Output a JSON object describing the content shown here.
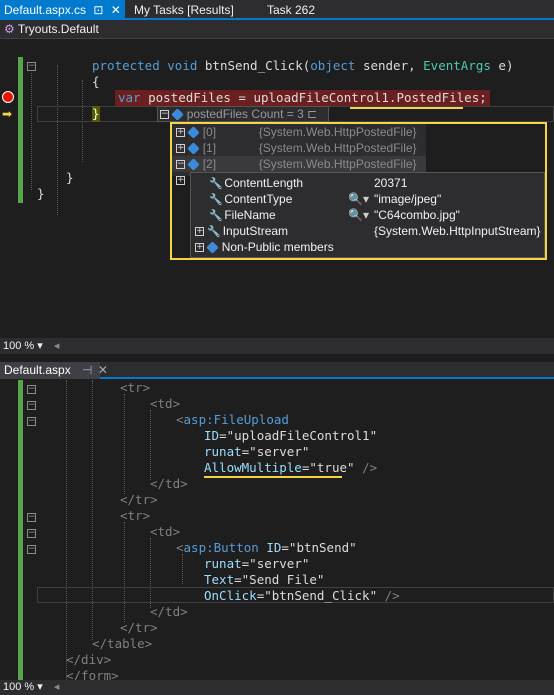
{
  "tabs": {
    "tab1": "Default.aspx.cs",
    "tab2": "My Tasks [Results]",
    "tab3": "Task 262"
  },
  "navbar": {
    "class_name": "Tryouts.Default"
  },
  "cs_code": {
    "l1_kw1": "protected",
    "l1_kw2": "void",
    "l1_name": " btnSend_Click(",
    "l1_kw3": "object",
    "l1_mid": " sender, ",
    "l1_ty": "EventArgs",
    "l1_end": " e)",
    "l2": "{",
    "l3_kw": "var",
    "l3_rest": " postedFiles = uploadFileControl1.PostedFiles;",
    "l4": "}",
    "l5": "}",
    "l6": "}"
  },
  "datatip": {
    "header": "postedFiles",
    "count": "Count = 3",
    "items": [
      {
        "index": "[0]",
        "value": "{System.Web.HttpPostedFile}"
      },
      {
        "index": "[1]",
        "value": "{System.Web.HttpPostedFile}"
      },
      {
        "index": "[2]",
        "value": "{System.Web.HttpPostedFile}"
      }
    ],
    "props": [
      {
        "name": "ContentLength",
        "value": "20371"
      },
      {
        "name": "ContentType",
        "value": "\"image/jpeg\""
      },
      {
        "name": "FileName",
        "value": "\"C64combo.jpg\""
      },
      {
        "name": "InputStream",
        "value": "{System.Web.HttpInputStream}"
      },
      {
        "name": "Non-Public members",
        "value": ""
      }
    ]
  },
  "zoom": {
    "top": "100 %",
    "bottom": "100 %"
  },
  "aspx_tab": {
    "title": "Default.aspx"
  },
  "aspx_code": {
    "tr_open": "<tr>",
    "td_open": "<td>",
    "fileupload_tag": "asp:FileUpload",
    "id_attr": "ID",
    "id_val": "\"uploadFileControl1\"",
    "runat_attr": "runat",
    "runat_val": "\"server\"",
    "allow_attr": "AllowMultiple",
    "allow_val": "\"true\"",
    "self_close": "/>",
    "td_close": "</td>",
    "tr_close": "</tr>",
    "button_tag": "asp:Button",
    "btn_id_val": "\"btnSend\"",
    "text_attr": "Text",
    "text_val": "\"Send File\"",
    "onclick_attr": "OnClick",
    "onclick_val": "\"btnSend_Click\"",
    "table_close": "</table>",
    "div_close": "</div>",
    "form_close": "</form>",
    "lt": "<",
    "eq": "="
  },
  "colors": {
    "accent": "#007acc",
    "highlight": "#f5d547",
    "breakpoint": "#e51400"
  }
}
